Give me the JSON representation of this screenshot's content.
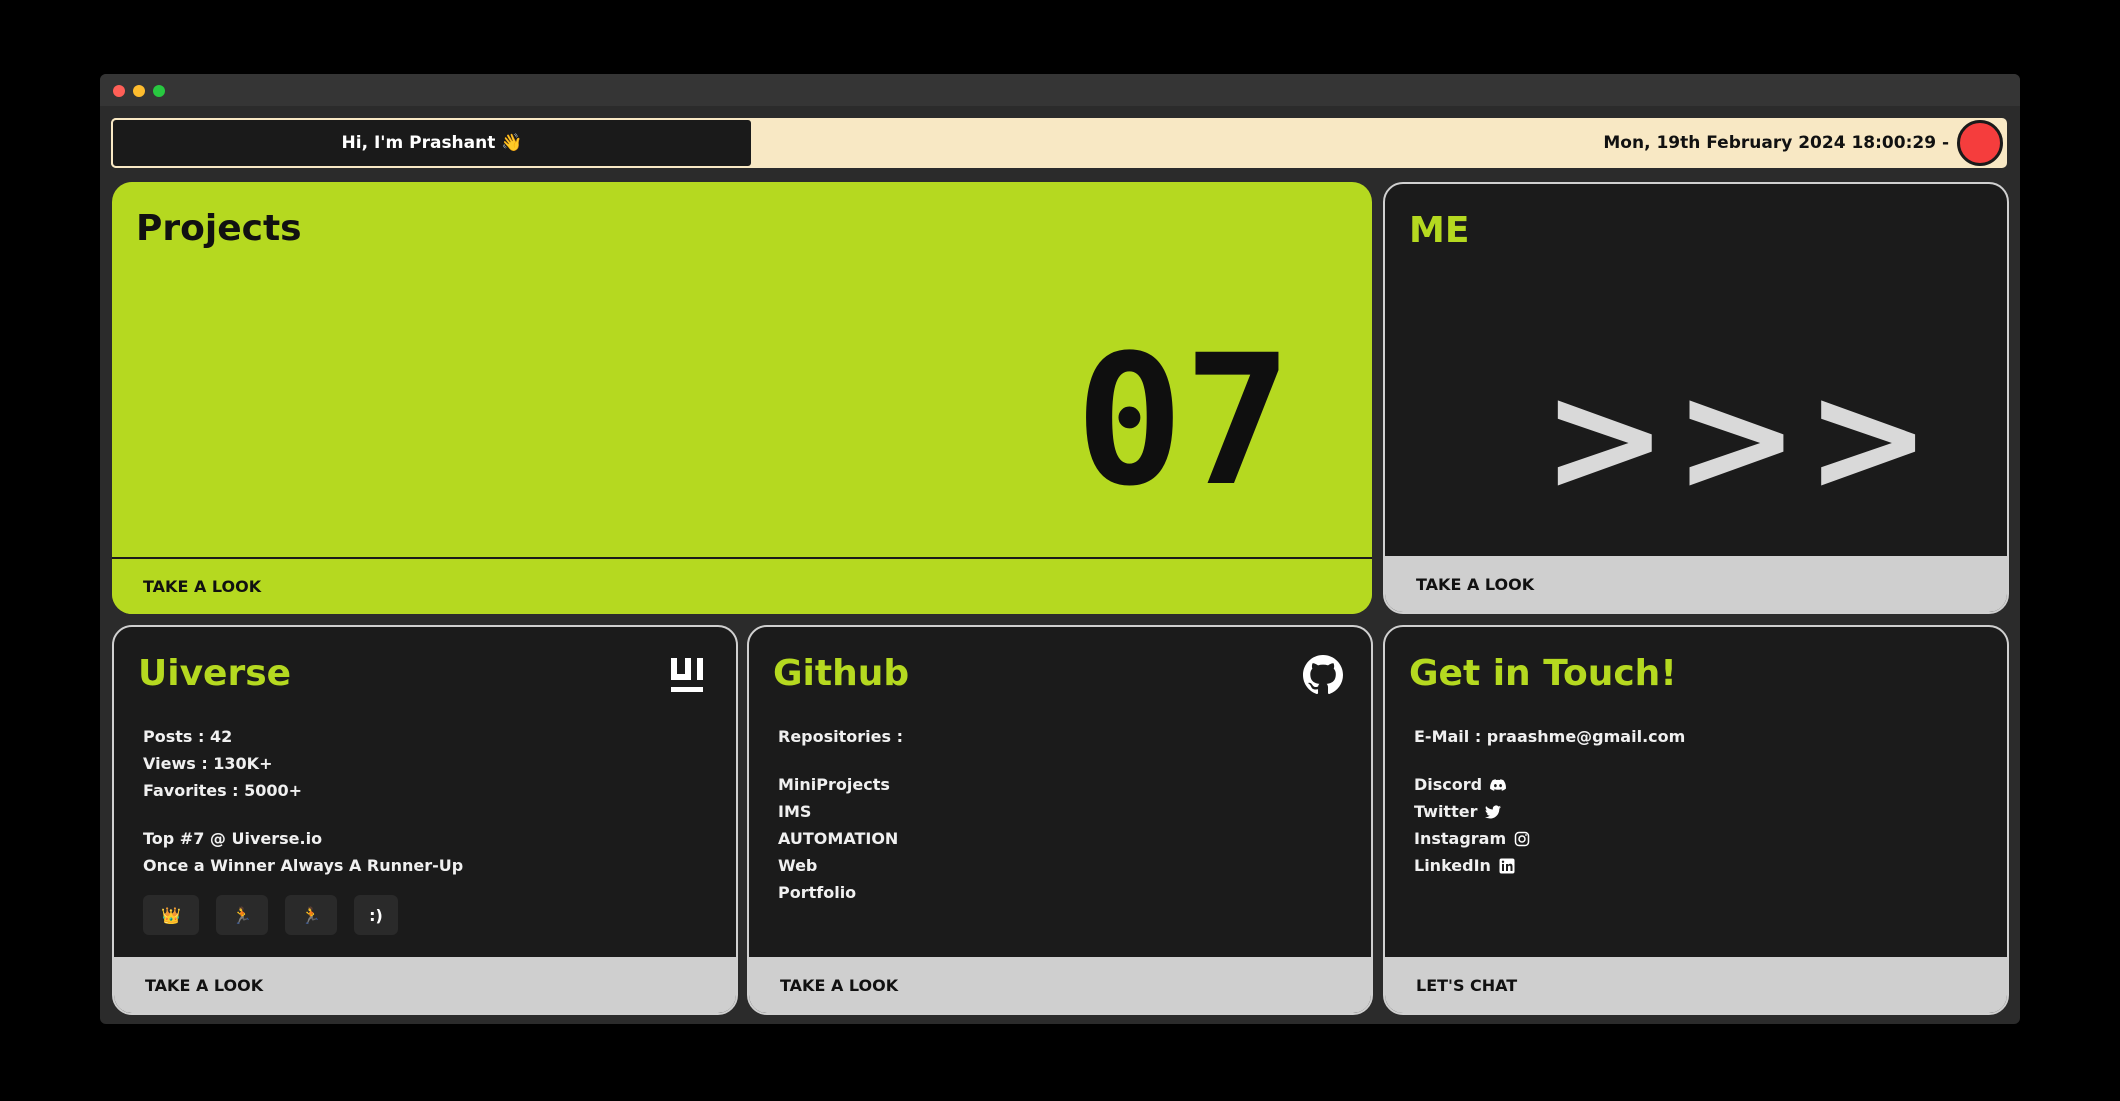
{
  "header": {
    "greeting": "Hi, I'm Prashant 👋",
    "datetime": "Mon, 19th February 2024 18:00:29 -"
  },
  "projects": {
    "title": "Projects",
    "count": "07",
    "cta": "TAKE A LOOK"
  },
  "me": {
    "title": "ME",
    "arrows": ">>>",
    "cta": "TAKE A LOOK"
  },
  "uiverse": {
    "title": "Uiverse",
    "stats": [
      "Posts : 42",
      "Views : 130K+",
      "Favorites : 5000+"
    ],
    "rank": "Top #7 @ Uiverse.io",
    "motto": "Once a Winner Always A Runner-Up",
    "badges": [
      "👑",
      "🏃",
      "🏃",
      ":)"
    ],
    "cta": "TAKE A LOOK"
  },
  "github": {
    "title": "Github",
    "repos_label": "Repositories :",
    "repos": [
      "MiniProjects",
      "IMS",
      "AUTOMATION",
      "Web",
      "Portfolio"
    ],
    "cta": "TAKE A LOOK"
  },
  "contact": {
    "title": "Get in Touch!",
    "email": "E-Mail : praashme@gmail.com",
    "socials": [
      "Discord",
      "Twitter",
      "Instagram",
      "LinkedIn"
    ],
    "cta": "LET'S CHAT"
  },
  "colors": {
    "accent": "#b5d920",
    "status": "#f53d3d",
    "header_bg": "#f8e8c4"
  }
}
